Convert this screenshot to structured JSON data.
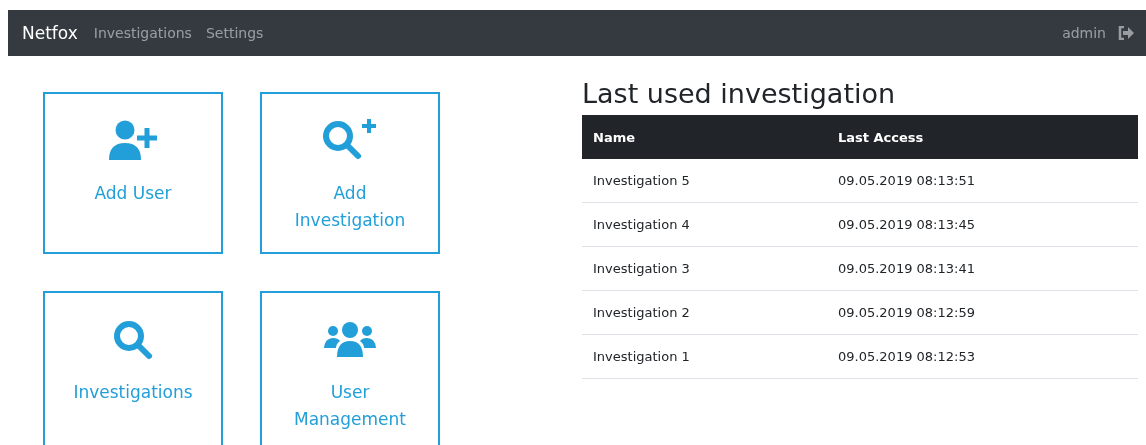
{
  "navbar": {
    "brand": "Netfox",
    "links": [
      "Investigations",
      "Settings"
    ],
    "user": "admin"
  },
  "tiles": [
    {
      "label": "Add User"
    },
    {
      "label": "Add Investigation"
    },
    {
      "label": "Investigations"
    },
    {
      "label": "User Management"
    }
  ],
  "last_used": {
    "title": "Last used investigation",
    "columns": [
      "Name",
      "Last Access"
    ],
    "rows": [
      [
        "Investigation 5",
        "09.05.2019 08:13:51"
      ],
      [
        "Investigation 4",
        "09.05.2019 08:13:45"
      ],
      [
        "Investigation 3",
        "09.05.2019 08:13:41"
      ],
      [
        "Investigation 2",
        "09.05.2019 08:12:59"
      ],
      [
        "Investigation 1",
        "09.05.2019 08:12:53"
      ]
    ]
  }
}
